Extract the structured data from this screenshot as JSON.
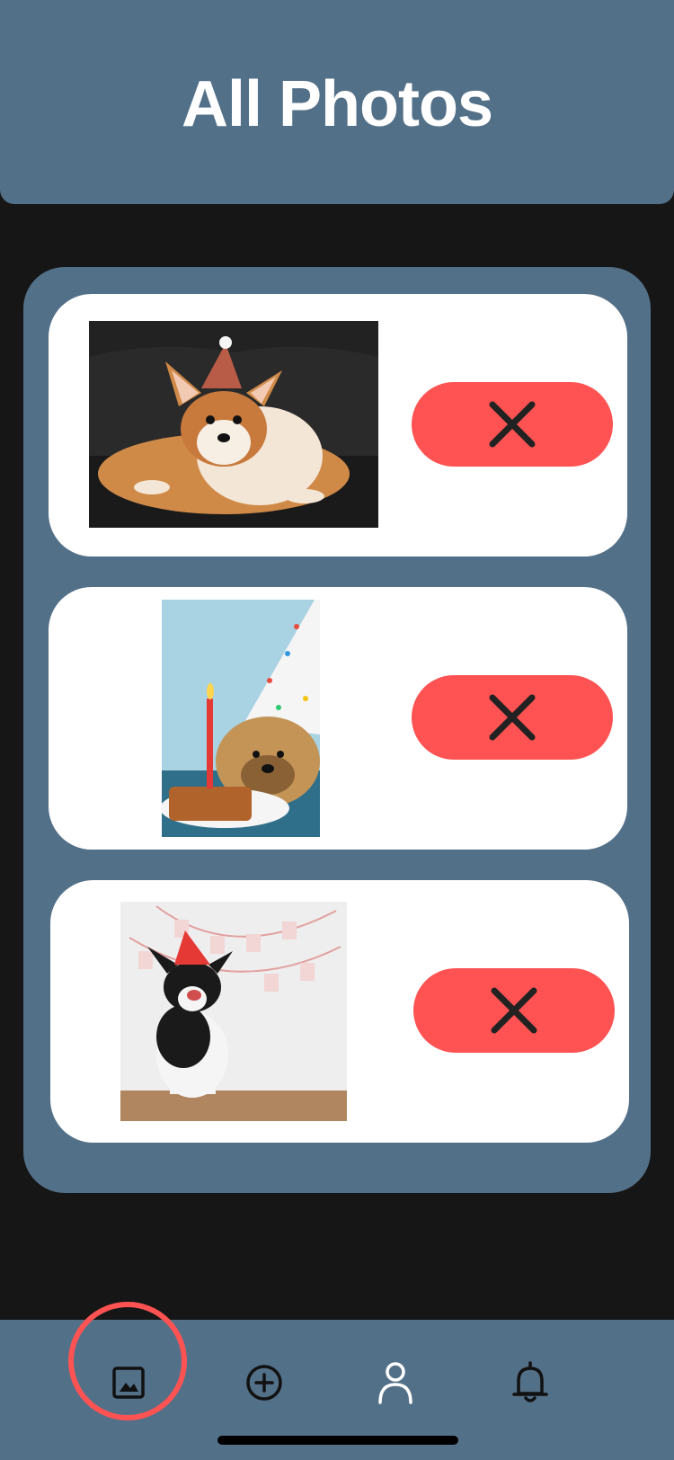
{
  "header": {
    "title": "All Photos"
  },
  "photos": [
    {
      "description": "corgi",
      "delete_icon": "close-icon"
    },
    {
      "description": "dog-with-cake",
      "delete_icon": "close-icon"
    },
    {
      "description": "dog-happy-birthday",
      "delete_icon": "close-icon"
    }
  ],
  "tabbar": {
    "items": [
      {
        "icon": "photos-icon",
        "active": true
      },
      {
        "icon": "add-circle-icon",
        "active": false
      },
      {
        "icon": "profile-icon",
        "active": false
      },
      {
        "icon": "bell-icon",
        "active": false
      }
    ],
    "active_ring_color": "#fe5352"
  },
  "colors": {
    "background": "#161616",
    "header": "#537089",
    "panel": "#537089",
    "card": "#ffffff",
    "delete_button": "#fe5352"
  }
}
